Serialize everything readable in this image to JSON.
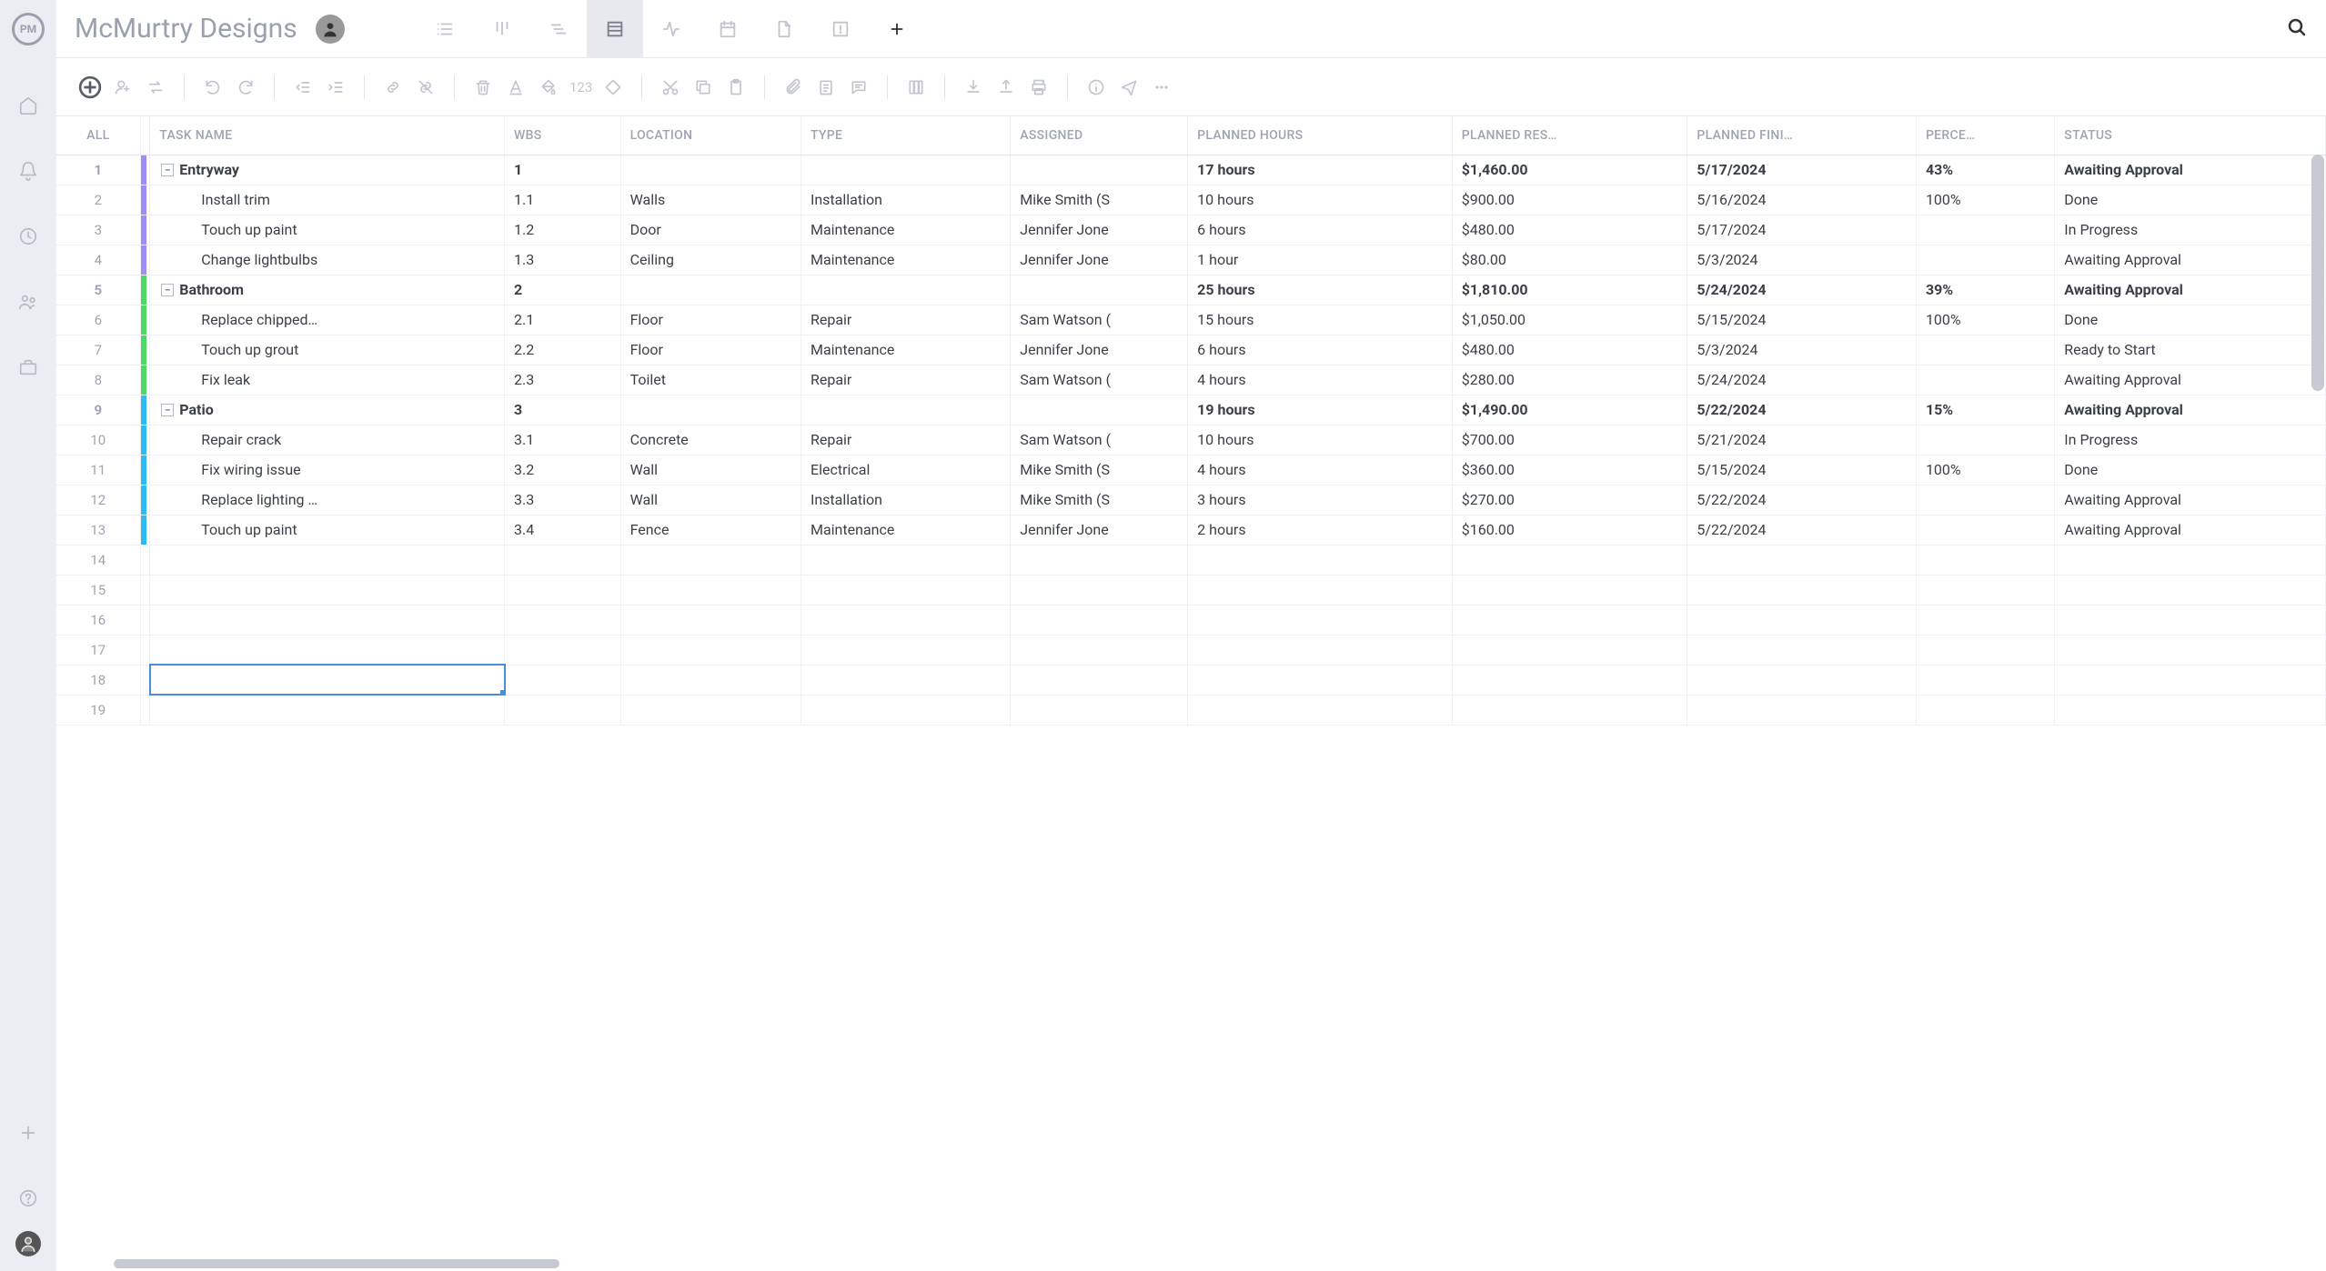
{
  "project_title": "McMurtry Designs",
  "columns": {
    "all": "ALL",
    "task": "TASK NAME",
    "wbs": "WBS",
    "location": "LOCATION",
    "type": "TYPE",
    "assigned": "ASSIGNED",
    "planned_hours": "PLANNED HOURS",
    "planned_resource": "PLANNED RES…",
    "planned_finish": "PLANNED FINI…",
    "percent": "PERCE…",
    "status": "STATUS"
  },
  "rows": [
    {
      "n": "1",
      "summary": true,
      "color": "c-purple",
      "task": "Entryway",
      "wbs": "1",
      "location": "",
      "type": "",
      "assigned": "",
      "hours": "17 hours",
      "resource": "$1,460.00",
      "finish": "5/17/2024",
      "percent": "43%",
      "status": "Awaiting Approval"
    },
    {
      "n": "2",
      "summary": false,
      "color": "c-purple",
      "task": "Install trim",
      "wbs": "1.1",
      "location": "Walls",
      "type": "Installation",
      "assigned": "Mike Smith (S",
      "hours": "10 hours",
      "resource": "$900.00",
      "finish": "5/16/2024",
      "percent": "100%",
      "status": "Done"
    },
    {
      "n": "3",
      "summary": false,
      "color": "c-purple",
      "task": "Touch up paint",
      "wbs": "1.2",
      "location": "Door",
      "type": "Maintenance",
      "assigned": "Jennifer Jone",
      "hours": "6 hours",
      "resource": "$480.00",
      "finish": "5/17/2024",
      "percent": "",
      "status": "In Progress"
    },
    {
      "n": "4",
      "summary": false,
      "color": "c-purple",
      "task": "Change lightbulbs",
      "wbs": "1.3",
      "location": "Ceiling",
      "type": "Maintenance",
      "assigned": "Jennifer Jone",
      "hours": "1 hour",
      "resource": "$80.00",
      "finish": "5/3/2024",
      "percent": "",
      "status": "Awaiting Approval"
    },
    {
      "n": "5",
      "summary": true,
      "color": "c-green",
      "task": "Bathroom",
      "wbs": "2",
      "location": "",
      "type": "",
      "assigned": "",
      "hours": "25 hours",
      "resource": "$1,810.00",
      "finish": "5/24/2024",
      "percent": "39%",
      "status": "Awaiting Approval"
    },
    {
      "n": "6",
      "summary": false,
      "color": "c-green",
      "task": "Replace chipped…",
      "wbs": "2.1",
      "location": "Floor",
      "type": "Repair",
      "assigned": "Sam Watson (",
      "hours": "15 hours",
      "resource": "$1,050.00",
      "finish": "5/15/2024",
      "percent": "100%",
      "status": "Done"
    },
    {
      "n": "7",
      "summary": false,
      "color": "c-green",
      "task": "Touch up grout",
      "wbs": "2.2",
      "location": "Floor",
      "type": "Maintenance",
      "assigned": "Jennifer Jone",
      "hours": "6 hours",
      "resource": "$480.00",
      "finish": "5/3/2024",
      "percent": "",
      "status": "Ready to Start"
    },
    {
      "n": "8",
      "summary": false,
      "color": "c-green",
      "task": "Fix leak",
      "wbs": "2.3",
      "location": "Toilet",
      "type": "Repair",
      "assigned": "Sam Watson (",
      "hours": "4 hours",
      "resource": "$280.00",
      "finish": "5/24/2024",
      "percent": "",
      "status": "Awaiting Approval"
    },
    {
      "n": "9",
      "summary": true,
      "color": "c-blue",
      "task": "Patio",
      "wbs": "3",
      "location": "",
      "type": "",
      "assigned": "",
      "hours": "19 hours",
      "resource": "$1,490.00",
      "finish": "5/22/2024",
      "percent": "15%",
      "status": "Awaiting Approval"
    },
    {
      "n": "10",
      "summary": false,
      "color": "c-blue",
      "task": "Repair crack",
      "wbs": "3.1",
      "location": "Concrete",
      "type": "Repair",
      "assigned": "Sam Watson (",
      "hours": "10 hours",
      "resource": "$700.00",
      "finish": "5/21/2024",
      "percent": "",
      "status": "In Progress"
    },
    {
      "n": "11",
      "summary": false,
      "color": "c-blue",
      "task": "Fix wiring issue",
      "wbs": "3.2",
      "location": "Wall",
      "type": "Electrical",
      "assigned": "Mike Smith (S",
      "hours": "4 hours",
      "resource": "$360.00",
      "finish": "5/15/2024",
      "percent": "100%",
      "status": "Done"
    },
    {
      "n": "12",
      "summary": false,
      "color": "c-blue",
      "task": "Replace lighting …",
      "wbs": "3.3",
      "location": "Wall",
      "type": "Installation",
      "assigned": "Mike Smith (S",
      "hours": "3 hours",
      "resource": "$270.00",
      "finish": "5/22/2024",
      "percent": "",
      "status": "Awaiting Approval"
    },
    {
      "n": "13",
      "summary": false,
      "color": "c-blue",
      "task": "Touch up paint",
      "wbs": "3.4",
      "location": "Fence",
      "type": "Maintenance",
      "assigned": "Jennifer Jone",
      "hours": "2 hours",
      "resource": "$160.00",
      "finish": "5/22/2024",
      "percent": "",
      "status": "Awaiting Approval"
    }
  ],
  "empty_rows": [
    "14",
    "15",
    "16",
    "17",
    "18",
    "19"
  ],
  "selected_empty": "18",
  "toolbar_number": "123"
}
